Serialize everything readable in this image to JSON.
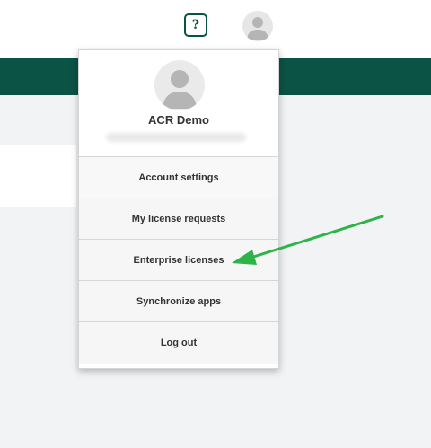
{
  "header": {
    "help_label": "?",
    "avatar_icon": "user-avatar-icon"
  },
  "dropdown": {
    "profile": {
      "name": "ACR Demo",
      "avatar_icon": "user-avatar-icon"
    },
    "items": [
      {
        "label": "Account settings"
      },
      {
        "label": "My license requests"
      },
      {
        "label": "Enterprise licenses"
      },
      {
        "label": "Synchronize apps"
      },
      {
        "label": "Log out"
      }
    ]
  },
  "colors": {
    "brand_green": "#0b5345",
    "annotation_arrow": "#2db34a"
  }
}
